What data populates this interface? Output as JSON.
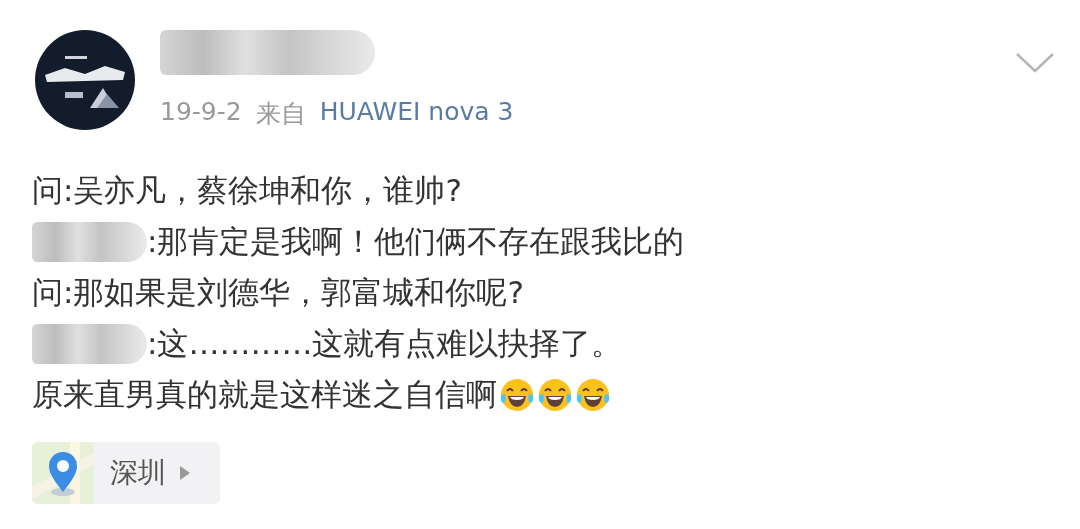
{
  "header": {
    "author_redacted": true,
    "date": "19-9-2",
    "source_prefix": "来自",
    "source": "HUAWEI nova 3"
  },
  "post_lines": [
    {
      "redacted": false,
      "text": "问:吴亦凡，蔡徐坤和你，谁帅?"
    },
    {
      "redacted": true,
      "text": ":那肯定是我啊！他们俩不存在跟我比的"
    },
    {
      "redacted": false,
      "text": "问:那如果是刘德华，郭富城和你呢?"
    },
    {
      "redacted": true,
      "text": ":这…………这就有点难以抉择了。"
    },
    {
      "redacted": false,
      "text": "原来直男真的就是这样迷之自信啊",
      "emojis": [
        {
          "kind": "laughing-tears"
        },
        {
          "kind": "laughing-tears"
        },
        {
          "kind": "laughing-tears"
        }
      ]
    }
  ],
  "location": {
    "label": "深圳"
  }
}
